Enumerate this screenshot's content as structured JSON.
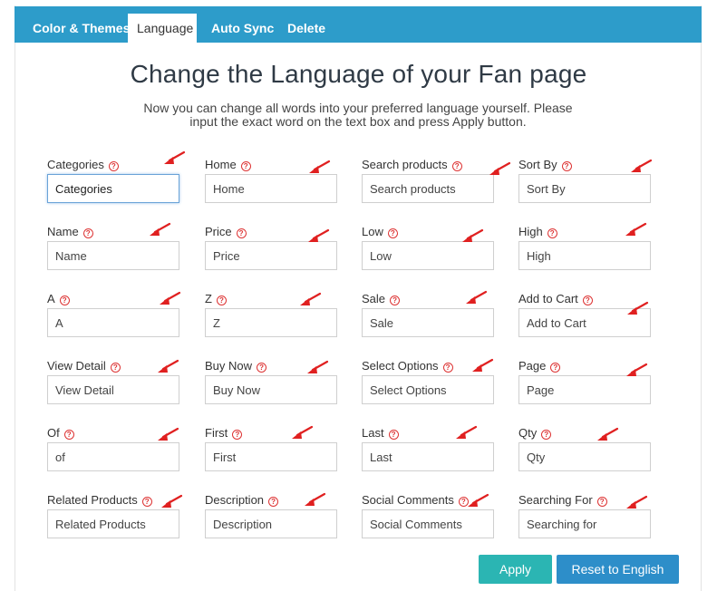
{
  "tabs": [
    {
      "label": "Color & Themes"
    },
    {
      "label": "Language",
      "active": true
    },
    {
      "label": "Auto Sync"
    },
    {
      "label": "Delete"
    }
  ],
  "heading": "Change the Language of your Fan page",
  "subtitle_line1": "Now you can change all words into your preferred language yourself. Please",
  "subtitle_line2": "input the exact word on the text box and press Apply button.",
  "help_glyph": "?",
  "fields": [
    {
      "label": "Categories",
      "value": "Categories"
    },
    {
      "label": "Home",
      "value": "Home"
    },
    {
      "label": "Search products",
      "value": "Search products"
    },
    {
      "label": "Sort By",
      "value": "Sort By"
    },
    {
      "label": "Name",
      "value": "Name"
    },
    {
      "label": "Price",
      "value": "Price"
    },
    {
      "label": "Low",
      "value": "Low"
    },
    {
      "label": "High",
      "value": "High"
    },
    {
      "label": "A",
      "value": "A"
    },
    {
      "label": "Z",
      "value": "Z"
    },
    {
      "label": "Sale",
      "value": "Sale"
    },
    {
      "label": "Add to Cart",
      "value": "Add to Cart"
    },
    {
      "label": "View Detail",
      "value": "View Detail"
    },
    {
      "label": "Buy Now",
      "value": "Buy Now"
    },
    {
      "label": "Select Options",
      "value": "Select Options"
    },
    {
      "label": "Page",
      "value": "Page"
    },
    {
      "label": "Of",
      "value": "of"
    },
    {
      "label": "First",
      "value": "First"
    },
    {
      "label": "Last",
      "value": "Last"
    },
    {
      "label": "Qty",
      "value": "Qty"
    },
    {
      "label": "Related Products",
      "value": "Related Products"
    },
    {
      "label": "Description",
      "value": "Description"
    },
    {
      "label": "Social Comments",
      "value": "Social Comments"
    },
    {
      "label": "Searching For",
      "value": "Searching for"
    }
  ],
  "buttons": {
    "apply": "Apply",
    "reset": "Reset to English"
  },
  "colors": {
    "tabbar": "#2d9cca",
    "apply": "#2bb5b3",
    "reset": "#2d8ec9",
    "help": "#dd3333",
    "annotation_arrow": "#e02020"
  }
}
